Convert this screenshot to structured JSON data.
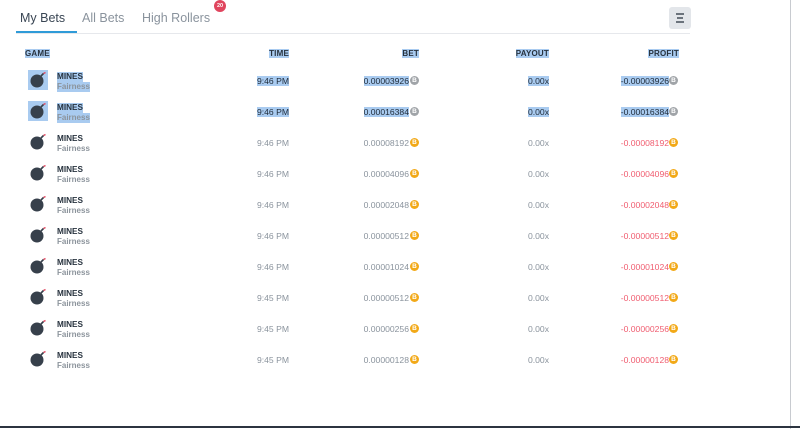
{
  "tabs": [
    {
      "label": "My Bets",
      "active": true
    },
    {
      "label": "All Bets",
      "active": false
    },
    {
      "label": "High Rollers",
      "active": false,
      "badge": "20"
    }
  ],
  "filter_icon": "filter-icon",
  "table": {
    "headers": {
      "game": "GAME",
      "time": "TIME",
      "bet": "BET",
      "payout": "PAYOUT",
      "profit": "PROFIT"
    },
    "rows": [
      {
        "game": "MINES",
        "sub": "Fairness",
        "time": "9:46 PM",
        "bet": "0.00003926",
        "payout": "0.00x",
        "profit": "-0.00003926",
        "selected": true
      },
      {
        "game": "MINES",
        "sub": "Fairness",
        "time": "9:46 PM",
        "bet": "0.00016384",
        "payout": "0.00x",
        "profit": "-0.00016384",
        "selected": true
      },
      {
        "game": "MINES",
        "sub": "Fairness",
        "time": "9:46 PM",
        "bet": "0.00008192",
        "payout": "0.00x",
        "profit": "-0.00008192",
        "selected": false
      },
      {
        "game": "MINES",
        "sub": "Fairness",
        "time": "9:46 PM",
        "bet": "0.00004096",
        "payout": "0.00x",
        "profit": "-0.00004096",
        "selected": false
      },
      {
        "game": "MINES",
        "sub": "Fairness",
        "time": "9:46 PM",
        "bet": "0.00002048",
        "payout": "0.00x",
        "profit": "-0.00002048",
        "selected": false
      },
      {
        "game": "MINES",
        "sub": "Fairness",
        "time": "9:46 PM",
        "bet": "0.00000512",
        "payout": "0.00x",
        "profit": "-0.00000512",
        "selected": false
      },
      {
        "game": "MINES",
        "sub": "Fairness",
        "time": "9:46 PM",
        "bet": "0.00001024",
        "payout": "0.00x",
        "profit": "-0.00001024",
        "selected": false
      },
      {
        "game": "MINES",
        "sub": "Fairness",
        "time": "9:45 PM",
        "bet": "0.00000512",
        "payout": "0.00x",
        "profit": "-0.00000512",
        "selected": false
      },
      {
        "game": "MINES",
        "sub": "Fairness",
        "time": "9:45 PM",
        "bet": "0.00000256",
        "payout": "0.00x",
        "profit": "-0.00000256",
        "selected": false
      },
      {
        "game": "MINES",
        "sub": "Fairness",
        "time": "9:45 PM",
        "bet": "0.00000128",
        "payout": "0.00x",
        "profit": "-0.00000128",
        "selected": false
      }
    ]
  },
  "coin_symbol": "B",
  "colors": {
    "accent": "#2f9bd8",
    "badge": "#e0455e",
    "loss": "#f05d70",
    "coin": "#f2a918",
    "selection": "#a9cbf0"
  }
}
